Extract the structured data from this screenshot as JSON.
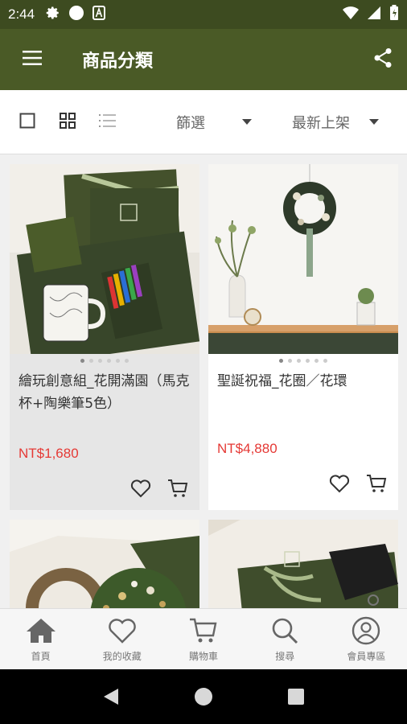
{
  "status_bar": {
    "time": "2:44",
    "left_icons": [
      "gear-icon",
      "circle-icon",
      "font-a-icon"
    ],
    "right_icons": [
      "wifi-icon",
      "signal-icon",
      "battery-icon"
    ]
  },
  "app_bar": {
    "title": "商品分類",
    "menu_icon": "hamburger-menu-icon",
    "share_icon": "share-icon"
  },
  "filter_bar": {
    "filter_label": "篩選",
    "sort_label": "最新上架",
    "view_modes": [
      "single-view-icon",
      "grid-view-icon",
      "list-view-icon"
    ],
    "active_view": "grid"
  },
  "products": [
    {
      "title": "繪玩創意組_花開滿園（馬克杯+陶樂筆5色）",
      "price": "NT$1,680",
      "image_count": 6,
      "active_image": 1
    },
    {
      "title": "聖誕祝福_花圈／花環",
      "price": "NT$4,880",
      "image_count": 6,
      "active_image": 1
    },
    {
      "title": "",
      "price": ""
    },
    {
      "title": "",
      "price": ""
    }
  ],
  "bottom_nav": [
    {
      "label": "首頁",
      "icon": "home-icon"
    },
    {
      "label": "我的收藏",
      "icon": "heart-icon"
    },
    {
      "label": "購物車",
      "icon": "cart-icon"
    },
    {
      "label": "搜尋",
      "icon": "search-icon"
    },
    {
      "label": "會員專區",
      "icon": "account-icon"
    }
  ],
  "colors": {
    "status_bar": "#3d4b20",
    "app_bar": "#4a5a26",
    "price": "#e53935",
    "nav_icon": "#666666"
  }
}
